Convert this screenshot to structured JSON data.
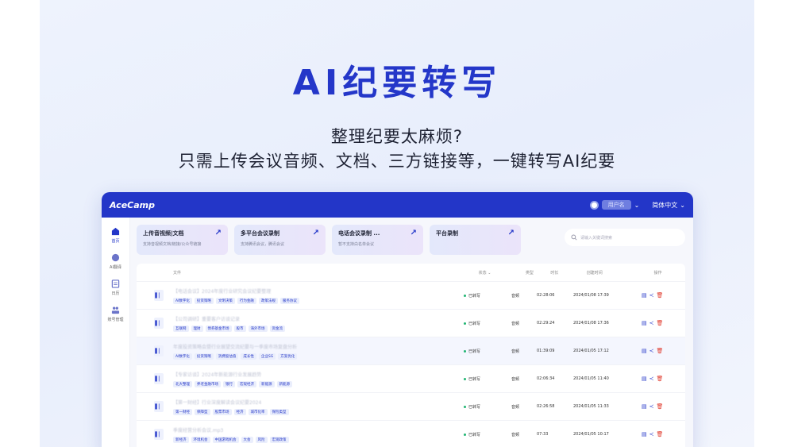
{
  "hero": {
    "title": "AI纪要转写",
    "subtitle_line1": "整理纪要太麻烦?",
    "subtitle_line2": "只需上传会议音频、文档、三方链接等，一键转写AI纪要"
  },
  "app": {
    "logo": "AceCamp",
    "user_name": "用户名",
    "language": "简体中文",
    "sidebar": [
      {
        "label": "首页",
        "icon": "home-icon"
      },
      {
        "label": "AI翻译",
        "icon": "translate-icon"
      },
      {
        "label": "日历",
        "icon": "calendar-icon"
      },
      {
        "label": "账号管理",
        "icon": "team-icon"
      }
    ],
    "cards": [
      {
        "title": "上传音视频|文档",
        "desc": "支持音视频文档/链接/公众号链接"
      },
      {
        "title": "多平台会议录制",
        "desc": "支持腾讯会议，腾讯会议"
      },
      {
        "title": "电话会议录制 ...",
        "desc": "暂不支持白名单会议"
      },
      {
        "title": "平台录制",
        "desc": ""
      }
    ],
    "search_placeholder": "请输入关键词搜索",
    "table": {
      "headers": {
        "file": "文件",
        "status": "状态",
        "type": "类型",
        "duration": "时长",
        "created": "创建时间",
        "ops": "操作"
      },
      "rows": [
        {
          "name": "【电话会议】2024年度行业研究会议纪要整理",
          "tags": [
            "AI数字化",
            "投资策略",
            "文明决策",
            "行为金融",
            "政策法规",
            "服务协议"
          ],
          "status": "已转写",
          "type": "音频",
          "duration": "02:28:06",
          "date": "2024/01/08 17:39"
        },
        {
          "name": "【公司调研】重要客户访谈记录",
          "tags": [
            "互联网",
            "理财",
            "债券基金市场",
            "股市",
            "海外市场",
            "资金流"
          ],
          "status": "已转写",
          "type": "音频",
          "duration": "02:29:24",
          "date": "2024/01/08 17:36"
        },
        {
          "name": "年度投资策略会暨行业展望交流纪要与一季度市场复盘分析",
          "tags": [
            "AI数字化",
            "投资策略",
            "消费股估值",
            "成长性",
            "企业SG",
            "方案优化"
          ],
          "status": "已转写",
          "type": "音频",
          "duration": "01:39:09",
          "date": "2024/01/05 17:12"
        },
        {
          "name": "【专家访谈】2024年新能源行业发展趋势",
          "tags": [
            "北大整理",
            "养老金融市场",
            "银行",
            "宏观经济",
            "新能源",
            "新能源"
          ],
          "status": "已转写",
          "type": "音频",
          "duration": "02:06:34",
          "date": "2024/01/05 11:40"
        },
        {
          "name": "【第一财经】行业深度解读会议纪要2024",
          "tags": [
            "第一财经",
            "保障型",
            "股票市场",
            "经济",
            "城市化率",
            "保险类型"
          ],
          "status": "已转写",
          "type": "音频",
          "duration": "02:26:58",
          "date": "2024/01/05 11:33"
        },
        {
          "name": "季度经营分析会议.mp3",
          "tags": [
            "新经济",
            "环境机会",
            "中国游戏机会",
            "大会",
            "风险",
            "宏观政策"
          ],
          "status": "已转写",
          "type": "音频",
          "duration": "07:33",
          "date": "2024/01/05 10:17"
        }
      ]
    }
  }
}
